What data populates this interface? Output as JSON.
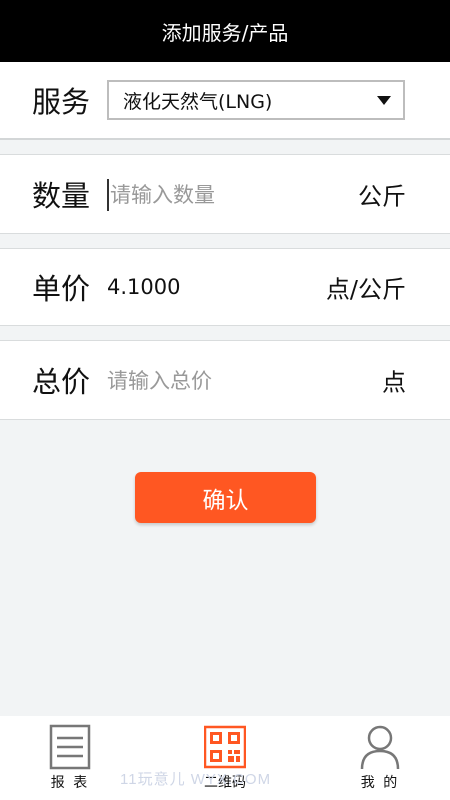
{
  "header": {
    "title": "添加服务/产品"
  },
  "service": {
    "label": "服务",
    "selected": "液化天然气(LNG)"
  },
  "quantity": {
    "label": "数量",
    "placeholder": "请输入数量",
    "unit": "公斤"
  },
  "unit_price": {
    "label": "单价",
    "value": "4.1000",
    "unit": "点/公斤"
  },
  "total": {
    "label": "总价",
    "placeholder": "请输入总价",
    "unit": "点"
  },
  "confirm_label": "确认",
  "colors": {
    "accent": "#ff5722",
    "header_bg": "#000000",
    "page_bg": "#f2f4f5"
  },
  "tabs": [
    {
      "label": "报 表",
      "icon": "report-list-icon"
    },
    {
      "label": "二维码",
      "icon": "qr-code-icon"
    },
    {
      "label": "我 的",
      "icon": "person-icon"
    }
  ],
  "watermark": "11玩意儿 WYX.COM"
}
